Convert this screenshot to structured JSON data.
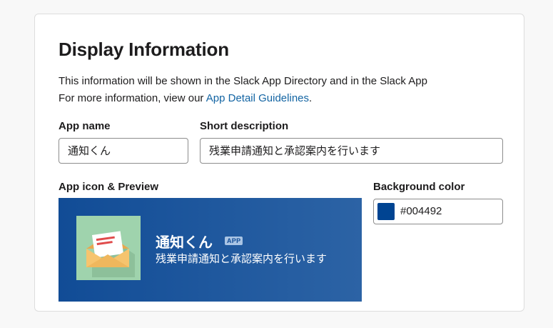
{
  "section": {
    "title": "Display Information",
    "description_line1": "This information will be shown in the Slack App Directory and in the Slack App",
    "description_line2_prefix": "For more information, view our ",
    "guidelines_link": "App Detail Guidelines",
    "description_line2_suffix": "."
  },
  "app_name_field": {
    "label": "App name",
    "value": "通知くん"
  },
  "short_description_field": {
    "label": "Short description",
    "value": "残業申請通知と承認案内を行います"
  },
  "preview": {
    "label": "App icon & Preview",
    "app_name": "通知くん",
    "badge": "APP",
    "description": "残業申請通知と承認案内を行います",
    "icon": "envelope-icon"
  },
  "background_color_field": {
    "label": "Background color",
    "value": "#004492",
    "swatch_color": "#004492"
  }
}
